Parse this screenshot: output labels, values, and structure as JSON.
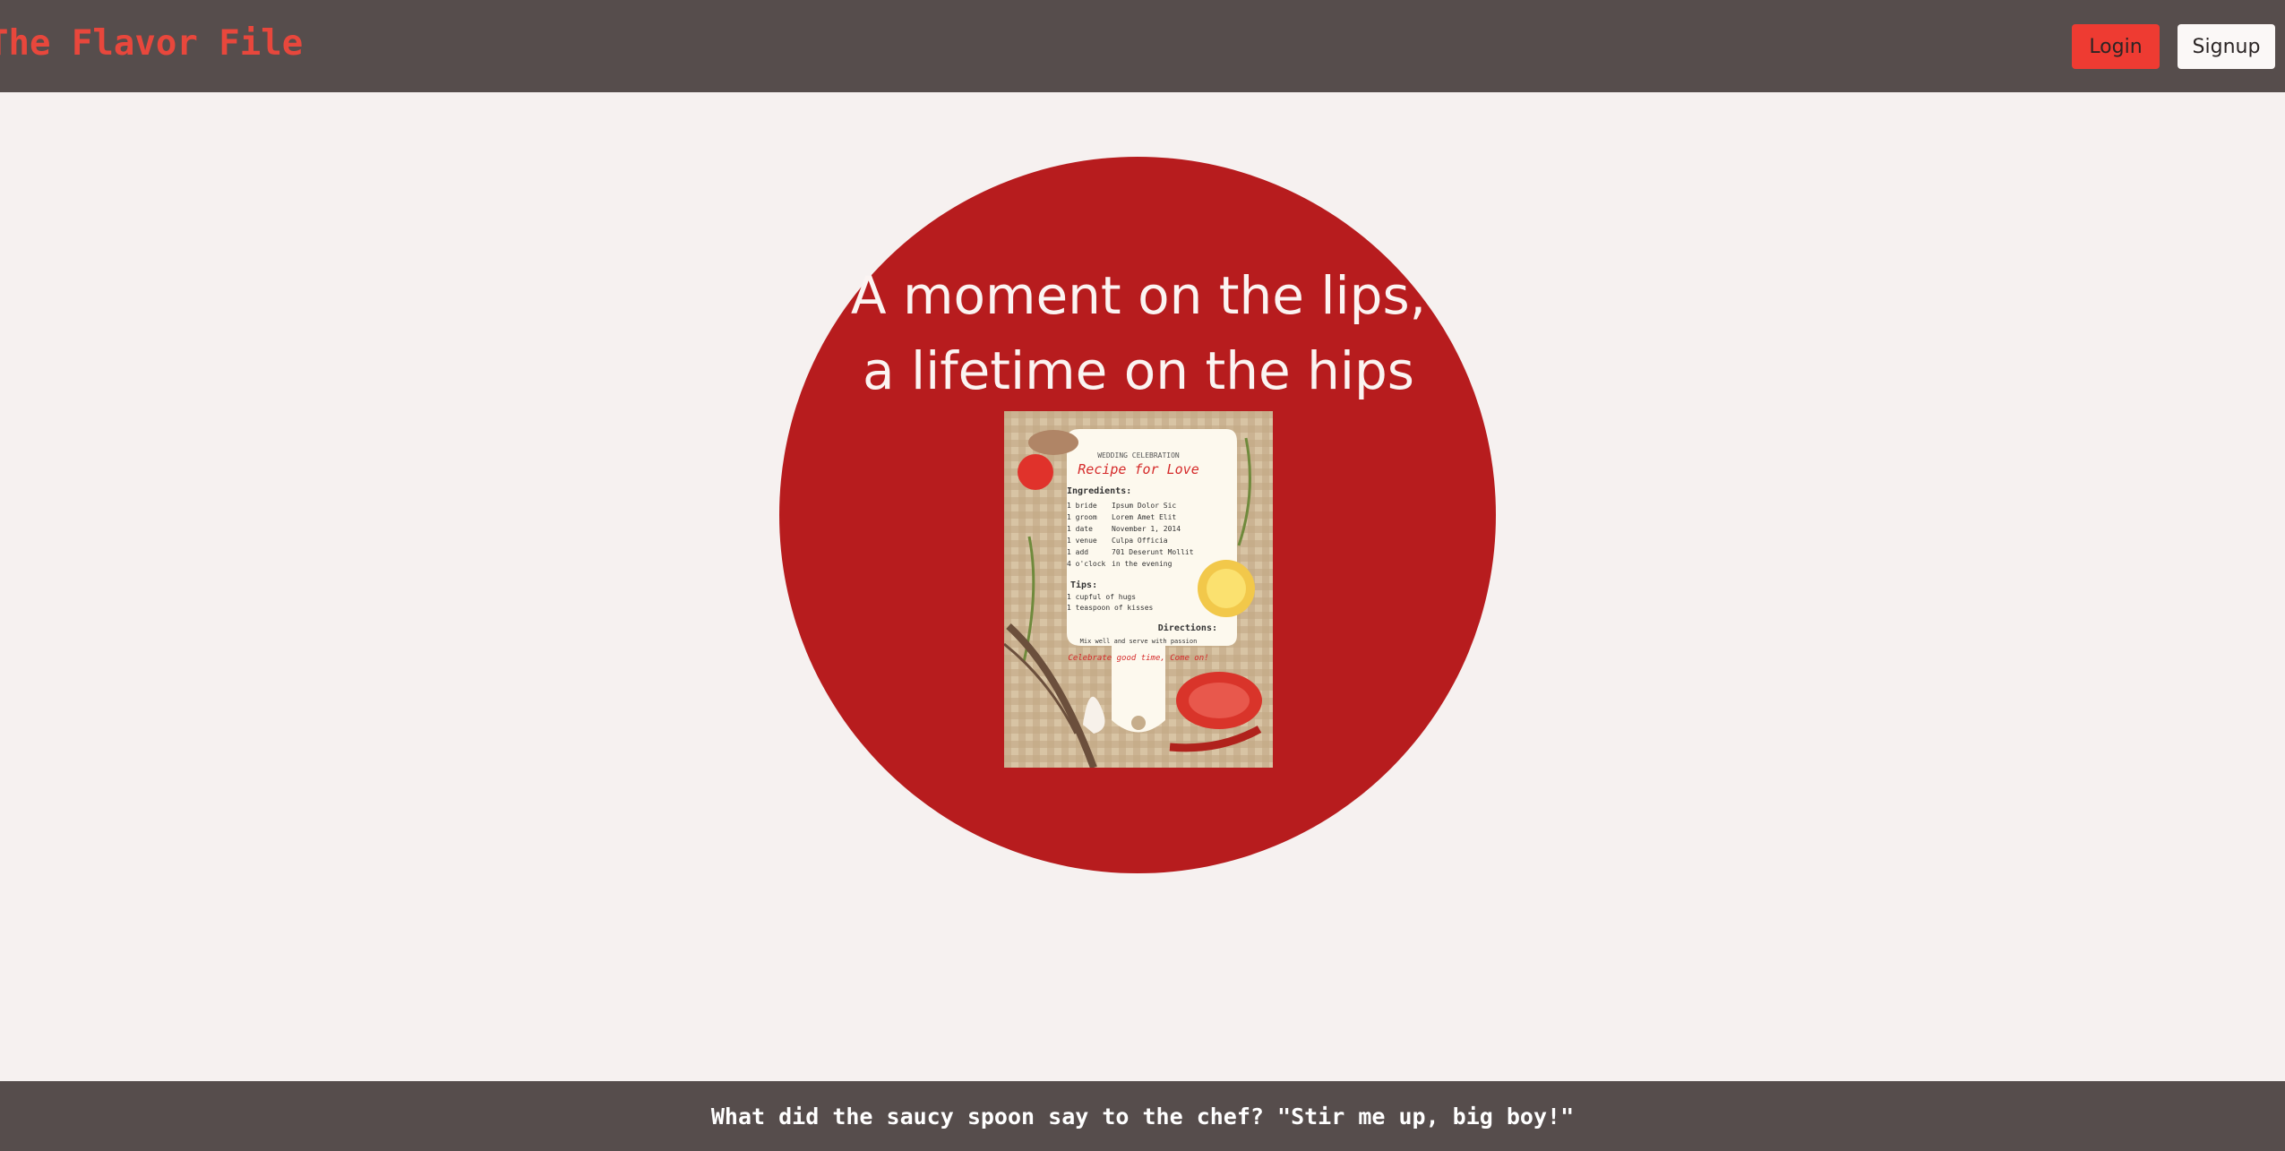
{
  "header": {
    "brand": "The Flavor File",
    "login_label": "Login",
    "signup_label": "Signup"
  },
  "hero": {
    "title": "A moment on the lips, a lifetime on the hips"
  },
  "card": {
    "subtitle": "WEDDING CELEBRATION",
    "title": "Recipe for Love",
    "ingredients_heading": "Ingredients:",
    "ingredients": [
      {
        "qty": "1 bride",
        "value": "Ipsum Dolor Sic"
      },
      {
        "qty": "1 groom",
        "value": "Lorem Amet Elit"
      },
      {
        "qty": "1 date",
        "value": "November 1, 2014"
      },
      {
        "qty": "1 venue",
        "value": "Culpa Officia"
      },
      {
        "qty": "1 add",
        "value": "701 Deserunt Mollit"
      },
      {
        "qty": "4 o'clock",
        "value": "in the evening"
      }
    ],
    "tips_heading": "Tips:",
    "tips": [
      "1 cupful of hugs",
      "1 teaspoon of kisses"
    ],
    "directions_heading": "Directions:",
    "directions": "Mix well and serve with passion",
    "closing": "Celebrate good time, Come on!"
  },
  "footer": {
    "joke": "What did the saucy spoon say to the chef? \"Stir me up, big boy!\""
  },
  "colors": {
    "header_bg": "#564d4c",
    "brand": "#e8473c",
    "hero_circle": "#b71c1e",
    "login_bg": "#ee3b32",
    "page_bg": "#f6f1f0"
  }
}
